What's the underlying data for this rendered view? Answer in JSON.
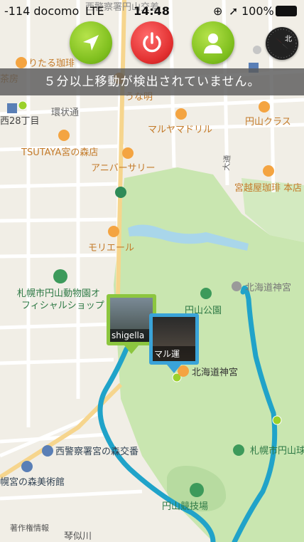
{
  "status_bar": {
    "carrier": "-114 docomo",
    "network": "LTE",
    "time": "14:48",
    "battery": "100%"
  },
  "banner_message": "５分以上移動が検出されていません。",
  "controls": {
    "navigate_icon": "navigation-arrow-icon",
    "power_icon": "power-icon",
    "profile_icon": "person-icon",
    "compass_icon": "compass-icon"
  },
  "pins": [
    {
      "label": "shigella",
      "color": "#8cc63f"
    },
    {
      "label": "マル運",
      "color": "#3aa3d8"
    }
  ],
  "map_labels": {
    "top_street": "西警察署円山交差",
    "cafe_top_left": "りたる珈琲",
    "sakan": "茶房",
    "nishi28": "西28丁目",
    "kanjodori": "環状通",
    "unamei": "うな明",
    "maruyama_class": "円山クラス",
    "maruyama_drill": "マルヤマドリル",
    "tsutaya": "TSUTAYA宮の森店",
    "anniversary": "アニバーサリー",
    "odori": "大通",
    "miyakoshiya": "宮越屋珈琲 本店",
    "moriel": "モリエール",
    "zoo_shop": "札幌市円山動物園オフィシャルショップ",
    "maruyama_park": "円山公園",
    "hokkaido_jingu_top": "北海道神宮",
    "hokkaido_jingu": "北海道神宮",
    "nishi_police_miyanomori": "西警察署宮の森交番",
    "sapporo_maruyama": "札幌市円山球",
    "miyanomori_museum": "幌宮の森美術館",
    "maruyama_stadium": "円山競技場",
    "copyright": "著作権情報",
    "kotonigawa": "琴似川"
  }
}
